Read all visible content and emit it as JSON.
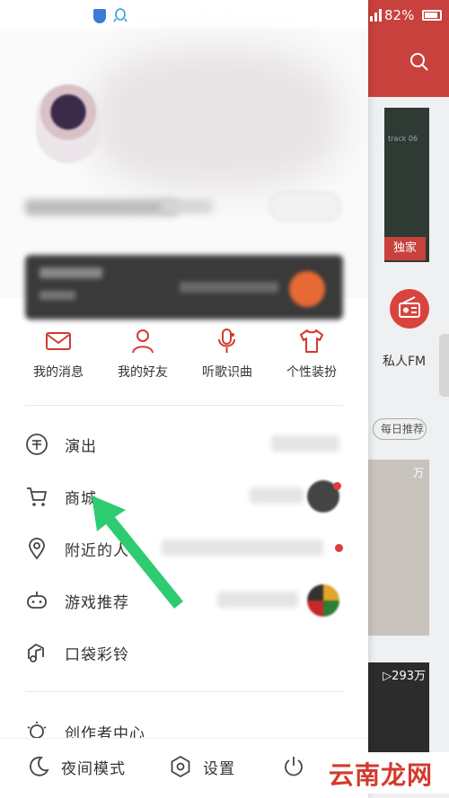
{
  "status_bar": {
    "battery_percent": "82%"
  },
  "background_app": {
    "badge_exclusive": "独家",
    "card_caption": "track 06",
    "fm_label": "私人FM",
    "pill_label": "每日推荐",
    "play_count_1": "万",
    "play_count_2": "▷293万"
  },
  "quick_grid": [
    {
      "label": "我的消息",
      "icon": "mail-icon"
    },
    {
      "label": "我的好友",
      "icon": "person-icon"
    },
    {
      "label": "听歌识曲",
      "icon": "mic-music-icon"
    },
    {
      "label": "个性装扮",
      "icon": "tshirt-icon"
    }
  ],
  "menu": [
    {
      "label": "演出",
      "icon": "ticket-icon"
    },
    {
      "label": "商城",
      "icon": "cart-icon"
    },
    {
      "label": "附近的人",
      "icon": "location-pin-icon"
    },
    {
      "label": "游戏推荐",
      "icon": "gamepad-icon"
    },
    {
      "label": "口袋彩铃",
      "icon": "ringtone-icon"
    },
    {
      "label": "创作者中心",
      "icon": "bulb-icon"
    }
  ],
  "bottom_bar": {
    "night_mode": "夜间模式",
    "settings": "设置"
  },
  "watermark": "云南龙网",
  "colors": {
    "accent": "#c8413c",
    "arrow": "#2ecc71"
  }
}
